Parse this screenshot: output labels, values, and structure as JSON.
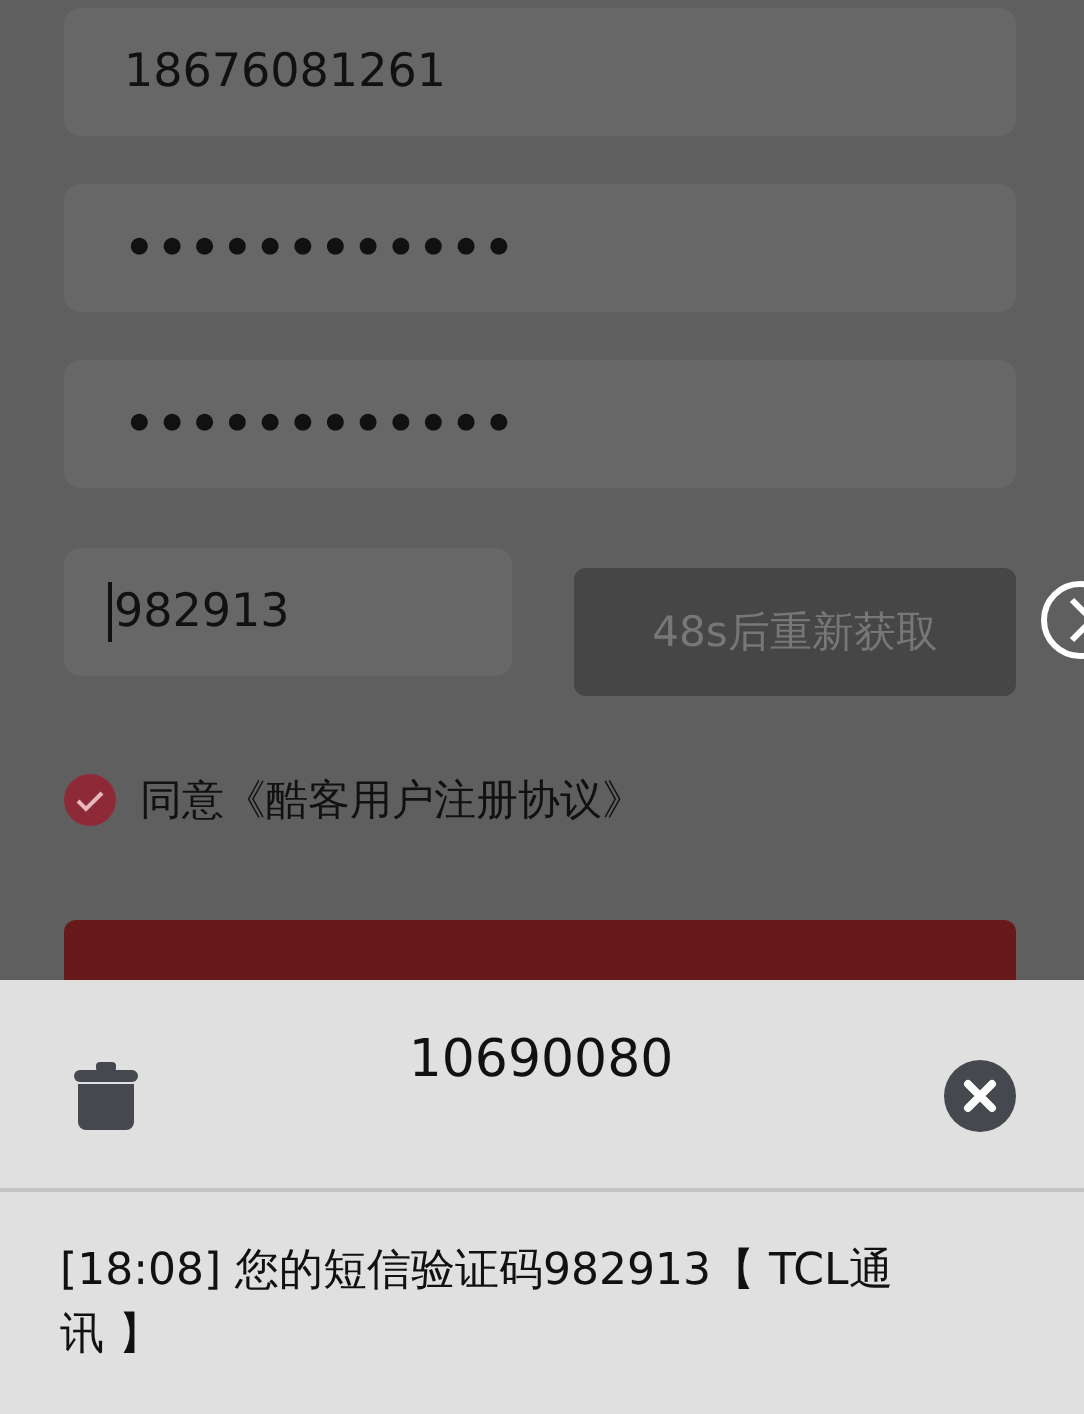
{
  "form": {
    "fields": [
      {
        "kind": "text",
        "value": "18676081261"
      },
      {
        "kind": "password",
        "value": "••••••••••••"
      },
      {
        "kind": "password",
        "value": "••••••••••••"
      }
    ],
    "code": {
      "value": "982913",
      "resend_button": {
        "label": "48s后重新获取",
        "disabled": true
      }
    },
    "agreement": {
      "checked": true,
      "label": "同意《酷客用户注册协议》"
    }
  },
  "sms_popup": {
    "sender": "10690080",
    "message": "[18:08]  您的短信验证码982913【 TCL通讯 】"
  }
}
